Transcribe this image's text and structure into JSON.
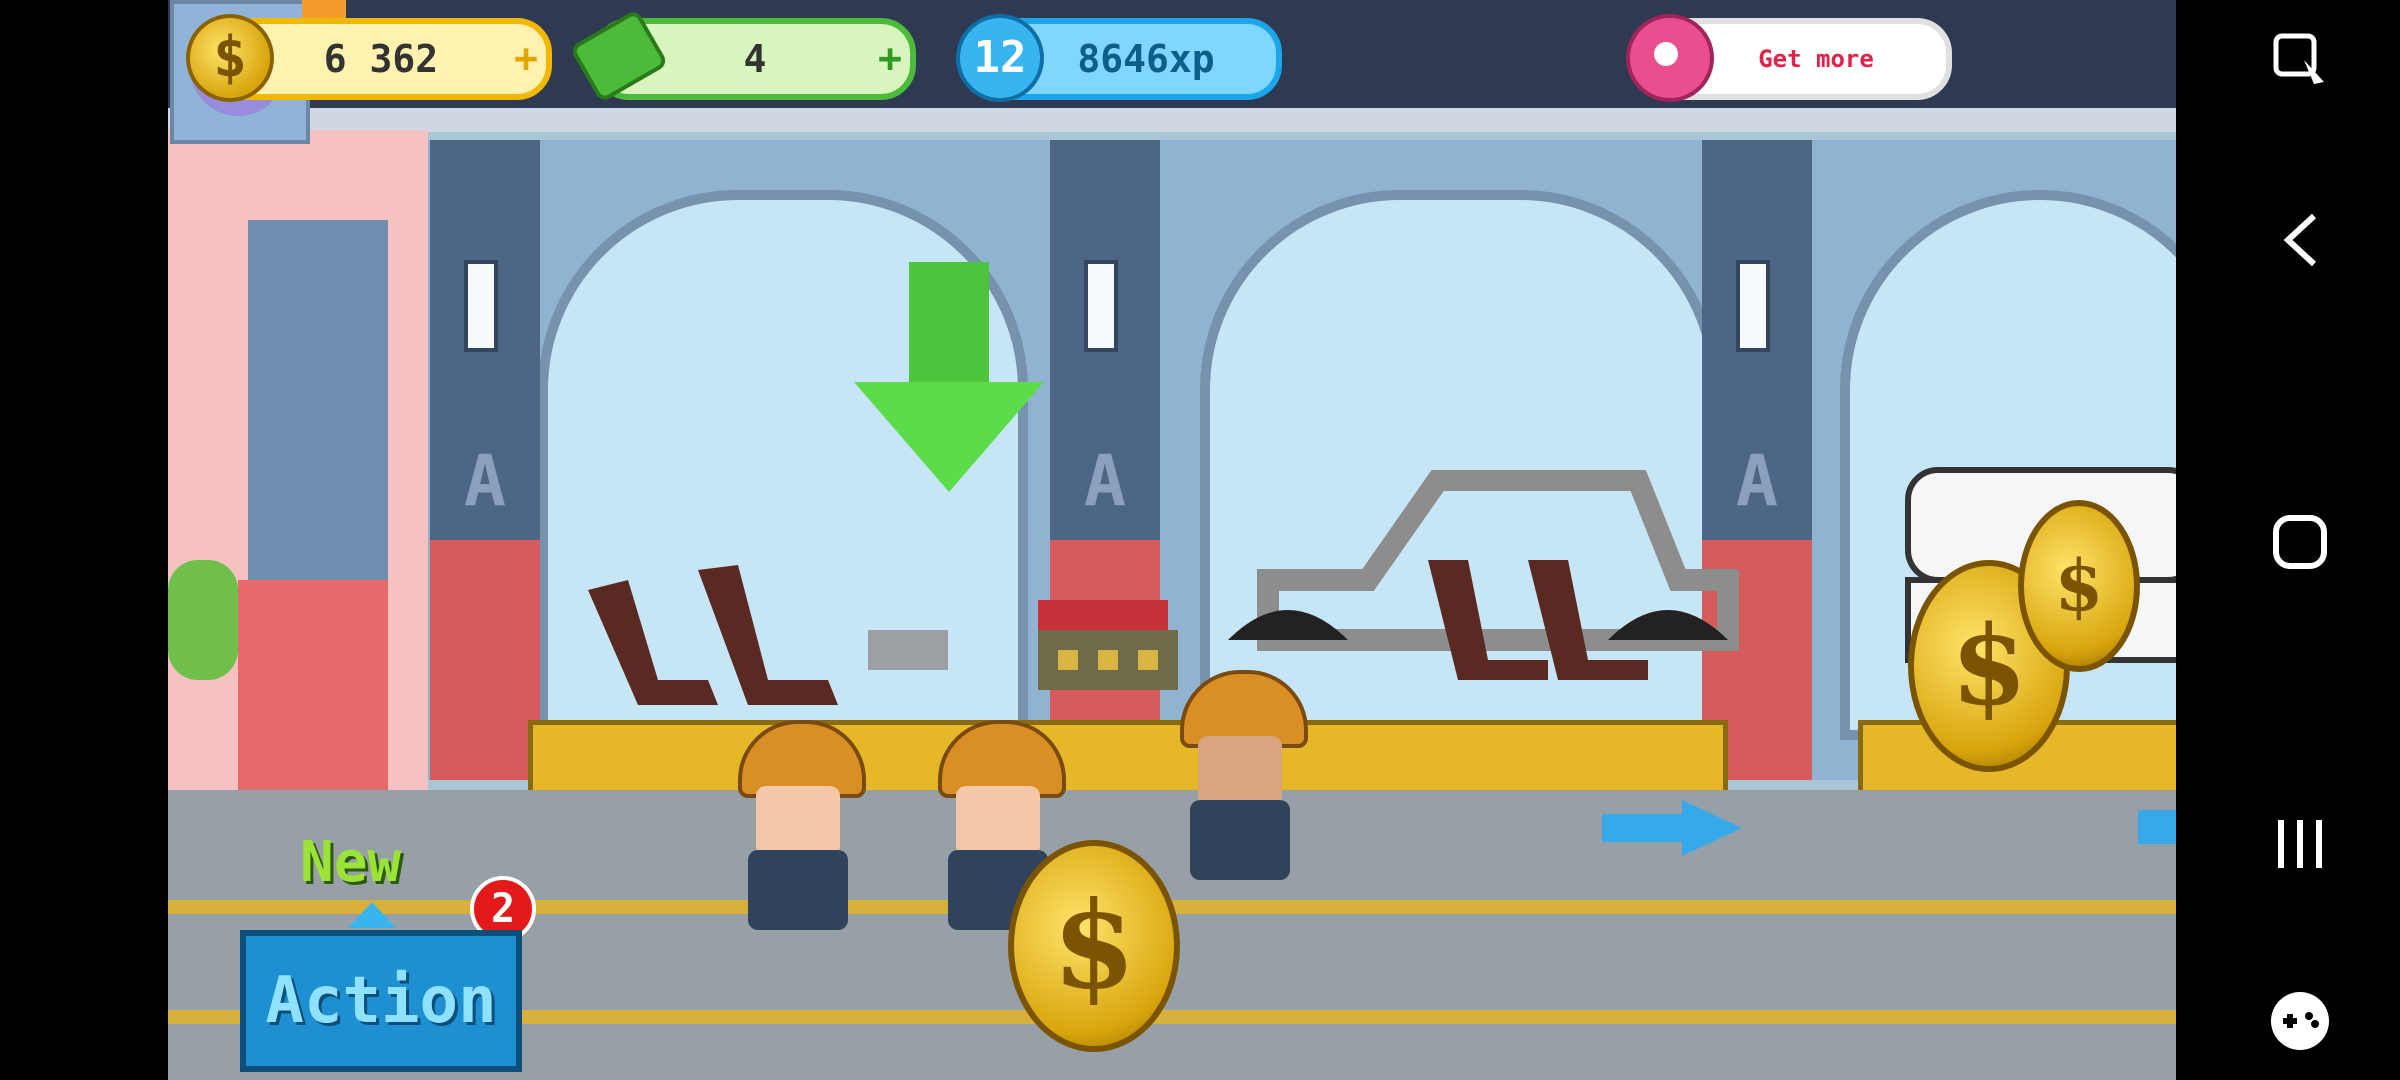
{
  "hud": {
    "coins": "6 362",
    "cash": "4",
    "level": "12",
    "xp": "8646xp",
    "get_more": "Get more"
  },
  "game": {
    "new_label": "New",
    "new_count": "2",
    "action_label": "Action"
  },
  "colors": {
    "coin_gold": "#f0b800",
    "cash_green": "#4dbb3a",
    "xp_blue": "#1aa6e8",
    "action_blue": "#1e8fd0",
    "donut_pink": "#e94f8f"
  },
  "icons": [
    "coin-icon",
    "cash-icon",
    "level-star-icon",
    "donut-icon",
    "wrench-icon",
    "screenshot-tool-icon",
    "back-icon",
    "home-icon",
    "recents-icon",
    "game-launcher-icon"
  ]
}
